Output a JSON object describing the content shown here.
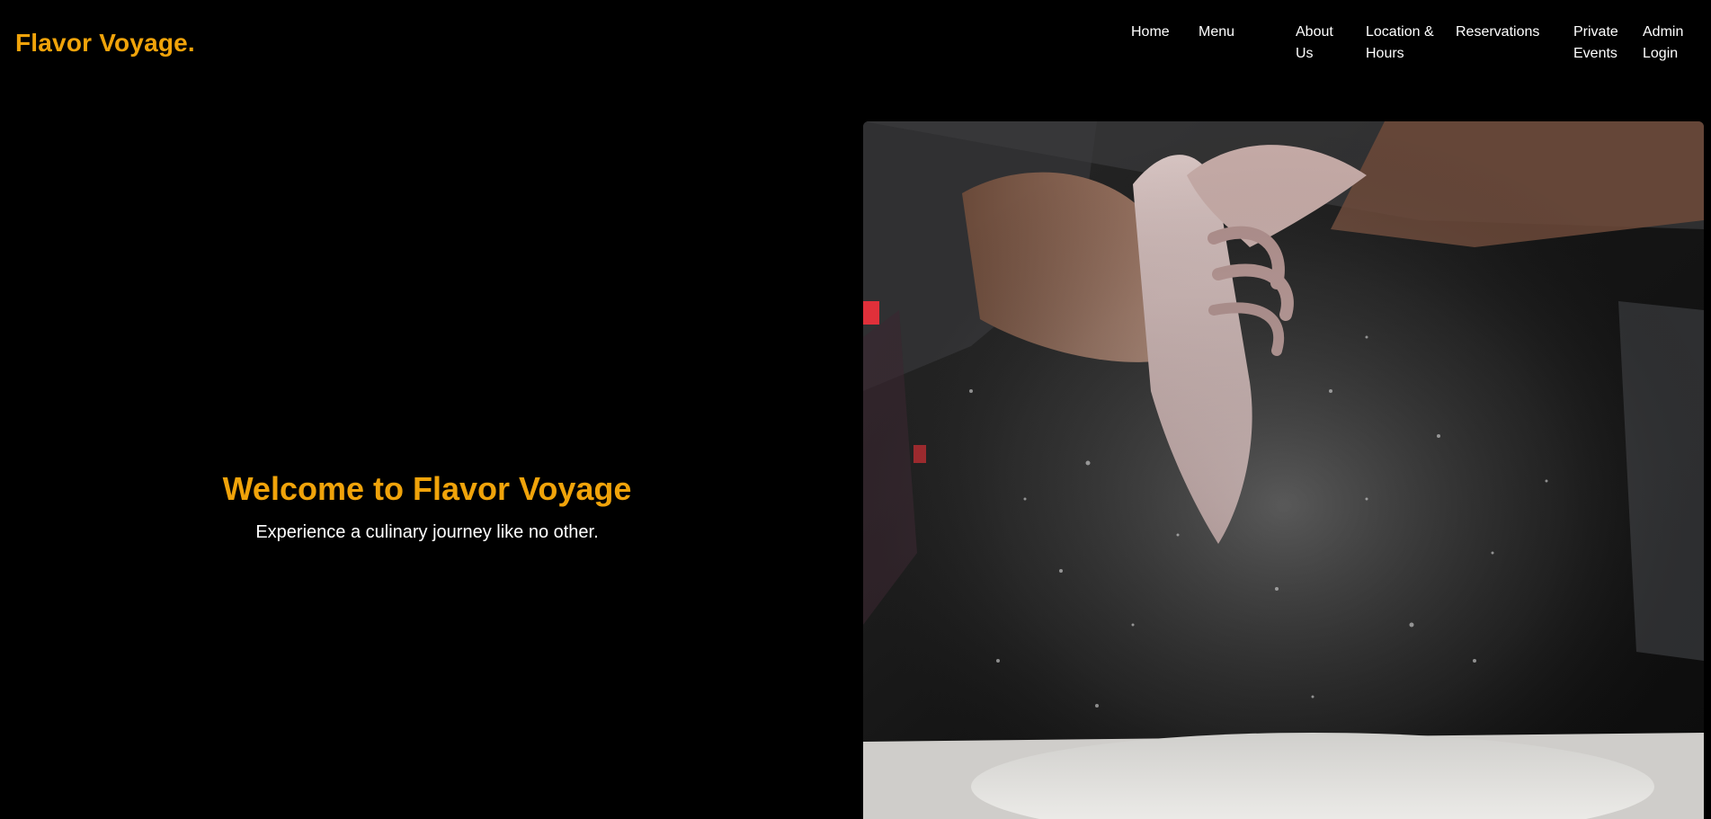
{
  "brand": {
    "name": "Flavor Voyage.",
    "color": "#f0a30a"
  },
  "nav": {
    "items": [
      {
        "label": "Home",
        "id": "home"
      },
      {
        "label": "Menu",
        "id": "menu"
      },
      {
        "label": "About Us",
        "id": "about-us"
      },
      {
        "label": "Location & Hours",
        "id": "location-hours"
      },
      {
        "label": "Reservations",
        "id": "reservations"
      },
      {
        "label": "Private Events",
        "id": "private-events"
      },
      {
        "label": "Admin Login",
        "id": "admin-login"
      }
    ]
  },
  "hero": {
    "title": "Welcome to Flavor Voyage",
    "subtitle": "Experience a culinary journey like no other.",
    "image_subject": "chef-hands-clapping-flour-over-dough"
  },
  "colors": {
    "background": "#000000",
    "accent": "#f0a30a",
    "text": "#ffffff"
  }
}
